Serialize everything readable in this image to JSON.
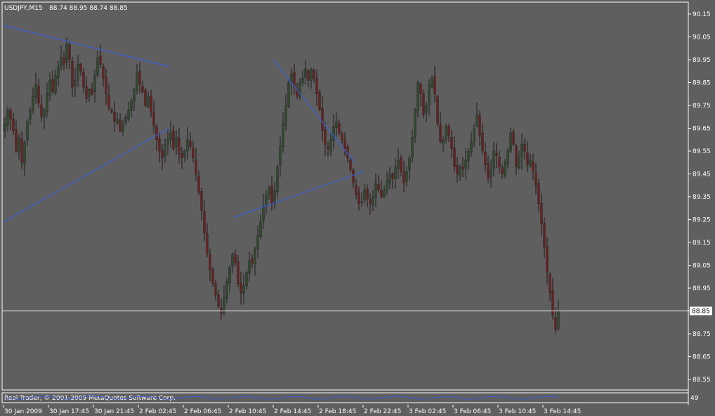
{
  "header": {
    "symbol": "USDJPY,M15",
    "ohlc": "88.74 88.95 88.74 88.85"
  },
  "indicator": {
    "label": "Real Trader, © 2001-2009 MetaQuotes Software Corp.",
    "value_label": "49"
  },
  "colors": {
    "background": "#5f5f5f",
    "grid_border": "#ffffff",
    "bull_candle": "#2f4a2f",
    "bear_candle": "#6b1f1f",
    "wick": "#1a1a1a",
    "trendline": "#3a5fd6",
    "price_line": "#ffffff"
  },
  "chart_data": {
    "type": "candlestick",
    "ylim": [
      88.5,
      90.2
    ],
    "y_ticks": [
      "90.15",
      "90.05",
      "89.95",
      "89.85",
      "89.75",
      "89.65",
      "89.55",
      "89.45",
      "89.35",
      "89.25",
      "89.15",
      "89.05",
      "88.95",
      "88.85",
      "88.75",
      "88.65",
      "88.55"
    ],
    "current_price": 88.85,
    "current_price_label": "88.85",
    "x_ticks": [
      {
        "label": "30 Jan 2009",
        "bar": 0
      },
      {
        "label": "30 Jan 17:45",
        "bar": 16
      },
      {
        "label": "30 Jan 21:45",
        "bar": 32
      },
      {
        "label": "2 Feb 02:45",
        "bar": 48
      },
      {
        "label": "2 Feb 06:45",
        "bar": 64
      },
      {
        "label": "2 Feb 10:45",
        "bar": 80
      },
      {
        "label": "2 Feb 14:45",
        "bar": 96
      },
      {
        "label": "2 Feb 18:45",
        "bar": 112
      },
      {
        "label": "2 Feb 22:45",
        "bar": 128
      },
      {
        "label": "3 Feb 02:45",
        "bar": 144
      },
      {
        "label": "3 Feb 06:45",
        "bar": 160
      },
      {
        "label": "3 Feb 10:45",
        "bar": 176
      },
      {
        "label": "3 Feb 14:45",
        "bar": 192
      }
    ],
    "bar_count": 200,
    "closes": [
      89.67,
      89.73,
      89.69,
      89.64,
      89.55,
      89.61,
      89.5,
      89.59,
      89.68,
      89.73,
      89.79,
      89.84,
      89.76,
      89.7,
      89.73,
      89.8,
      89.86,
      89.81,
      89.88,
      89.92,
      89.96,
      89.93,
      90.02,
      89.95,
      89.83,
      89.86,
      89.93,
      89.9,
      89.83,
      89.78,
      89.82,
      89.8,
      89.88,
      89.96,
      89.93,
      89.87,
      89.8,
      89.74,
      89.72,
      89.68,
      89.69,
      89.64,
      89.67,
      89.7,
      89.73,
      89.77,
      89.82,
      89.89,
      89.84,
      89.81,
      89.75,
      89.79,
      89.72,
      89.66,
      89.6,
      89.55,
      89.52,
      89.58,
      89.6,
      89.63,
      89.56,
      89.61,
      89.54,
      89.52,
      89.55,
      89.6,
      89.57,
      89.52,
      89.45,
      89.37,
      89.29,
      89.19,
      89.1,
      89.03,
      88.97,
      88.92,
      88.87,
      88.84,
      88.91,
      88.98,
      89.04,
      89.1,
      89.06,
      88.97,
      88.93,
      88.96,
      89.02,
      89.07,
      89.06,
      89.12,
      89.18,
      89.24,
      89.31,
      89.36,
      89.39,
      89.32,
      89.38,
      89.48,
      89.57,
      89.67,
      89.75,
      89.85,
      89.89,
      89.83,
      89.79,
      89.85,
      89.87,
      89.91,
      89.86,
      89.91,
      89.87,
      89.8,
      89.73,
      89.64,
      89.58,
      89.56,
      89.6,
      89.66,
      89.68,
      89.63,
      89.6,
      89.56,
      89.52,
      89.47,
      89.41,
      89.36,
      89.32,
      89.33,
      89.38,
      89.34,
      89.32,
      89.35,
      89.41,
      89.38,
      89.35,
      89.38,
      89.42,
      89.45,
      89.43,
      89.48,
      89.51,
      89.46,
      89.41,
      89.46,
      89.52,
      89.61,
      89.73,
      89.85,
      89.8,
      89.71,
      89.75,
      89.84,
      89.87,
      89.8,
      89.67,
      89.59,
      89.6,
      89.66,
      89.62,
      89.56,
      89.48,
      89.45,
      89.48,
      89.47,
      89.51,
      89.55,
      89.59,
      89.65,
      89.71,
      89.62,
      89.55,
      89.49,
      89.43,
      89.47,
      89.55,
      89.53,
      89.48,
      89.45,
      89.5,
      89.55,
      89.63,
      89.58,
      89.48,
      89.52,
      89.58,
      89.55,
      89.49,
      89.51,
      89.46,
      89.4,
      89.32,
      89.23,
      89.13,
      89.02,
      88.93,
      88.83,
      88.77,
      88.85
    ],
    "trendlines": [
      {
        "from": [
          0,
          90.1
        ],
        "to": [
          58,
          89.92
        ]
      },
      {
        "from": [
          0,
          89.24
        ],
        "to": [
          58,
          89.65
        ]
      },
      {
        "from": [
          82,
          89.26
        ],
        "to": [
          127,
          89.46
        ]
      },
      {
        "from": [
          96,
          89.95
        ],
        "to": [
          124,
          89.5
        ]
      }
    ]
  }
}
